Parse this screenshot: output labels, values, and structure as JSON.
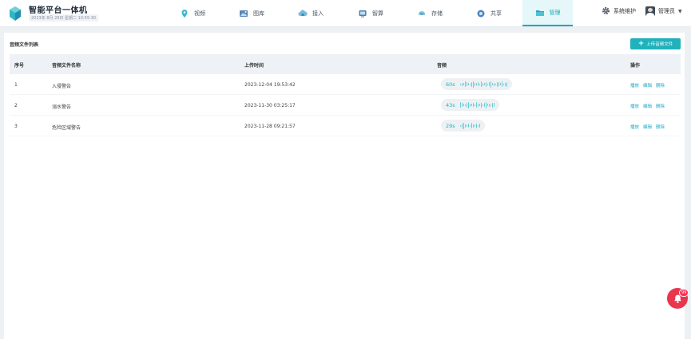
{
  "brand": {
    "title": "智能平台一体机",
    "date": "2023年 8月 29日  星期二  10:55:30",
    "accent": "#19aab8"
  },
  "nav": [
    {
      "label": "视频",
      "icon": "location-pin-icon"
    },
    {
      "label": "图库",
      "icon": "image-gallery-icon"
    },
    {
      "label": "接入",
      "icon": "cloud-access-icon"
    },
    {
      "label": "智算",
      "icon": "compute-icon"
    },
    {
      "label": "存储",
      "icon": "storage-icon"
    },
    {
      "label": "共享",
      "icon": "share-icon"
    },
    {
      "label": "管理",
      "icon": "folder-icon",
      "active": true
    }
  ],
  "system": {
    "label": "系统维护",
    "icon": "gear-icon"
  },
  "user": {
    "name": "管理员"
  },
  "panel": {
    "title": "音频文件列表",
    "upload_label": "上传音频文件"
  },
  "table": {
    "headers": [
      "序号",
      "音频文件名称",
      "上传时间",
      "音频",
      "操作"
    ],
    "rows": [
      {
        "index": "1",
        "name": "入侵警告",
        "time": "2023-12-04 19:53:42",
        "duration": "60s"
      },
      {
        "index": "2",
        "name": "溺水警告",
        "time": "2023-11-30 03:25:17",
        "duration": "43s"
      },
      {
        "index": "3",
        "name": "危险区域警告",
        "time": "2023-11-28 09:21:57",
        "duration": "29s"
      }
    ],
    "ops": {
      "play": "播放",
      "edit": "编辑",
      "delete": "删除"
    }
  },
  "notification": {
    "count": "99",
    "color": "#e8364e"
  }
}
